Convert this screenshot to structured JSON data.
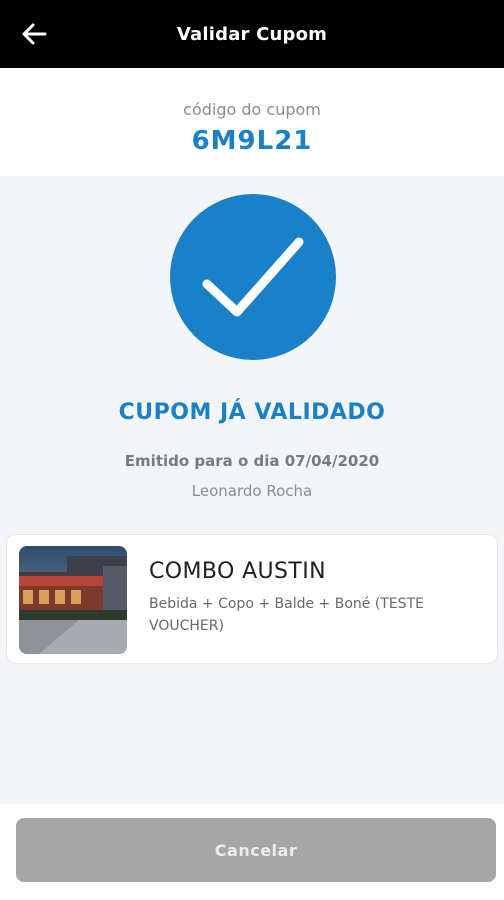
{
  "header": {
    "title": "Validar Cupom",
    "back_icon": "arrow-left-icon"
  },
  "coupon": {
    "code_label": "código do cupom",
    "code": "6M9L21"
  },
  "status": {
    "icon": "checkmark-icon",
    "title": "CUPOM JÁ VALIDADO",
    "issued_for": "Emitido para o dia 07/04/2020",
    "customer": "Leonardo Rocha"
  },
  "product": {
    "name": "COMBO AUSTIN",
    "description": "Bebida + Copo + Balde + Boné (TESTE VOUCHER)",
    "thumbnail": "restaurant-photo"
  },
  "footer": {
    "cancel_label": "Cancelar"
  },
  "colors": {
    "accent": "#1a81c8",
    "header_bg": "#000000",
    "button_disabled": "#a6a6a6"
  }
}
